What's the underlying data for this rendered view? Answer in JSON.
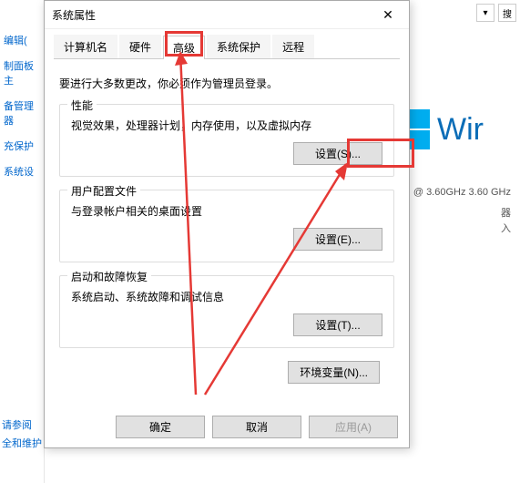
{
  "sidebar": {
    "items": [
      "编辑(",
      "制面板主",
      "备管理器",
      "充保护",
      "系统设"
    ]
  },
  "footer": {
    "link1": "请参阅",
    "link2": "全和维护"
  },
  "toolbar": {
    "search": "搜"
  },
  "dialog": {
    "title": "系统属性",
    "tabs": [
      "计算机名",
      "硬件",
      "高级",
      "系统保护",
      "远程"
    ],
    "active_tab": 2,
    "desc": "要进行大多数更改，你必须作为管理员登录。",
    "groups": [
      {
        "title": "性能",
        "text": "视觉效果，处理器计划，内存使用，以及虚拟内存",
        "btn": "设置(S)..."
      },
      {
        "title": "用户配置文件",
        "text": "与登录帐户相关的桌面设置",
        "btn": "设置(E)..."
      },
      {
        "title": "启动和故障恢复",
        "text": "系统启动、系统故障和调试信息",
        "btn": "设置(T)..."
      }
    ],
    "env_btn": "环境变量(N)...",
    "buttons": {
      "ok": "确定",
      "cancel": "取消",
      "apply": "应用(A)"
    }
  },
  "bg": {
    "win_text": "Wir",
    "cpu": "@ 3.60GHz  3.60 GHz",
    "label1": "器",
    "label2": "入"
  }
}
